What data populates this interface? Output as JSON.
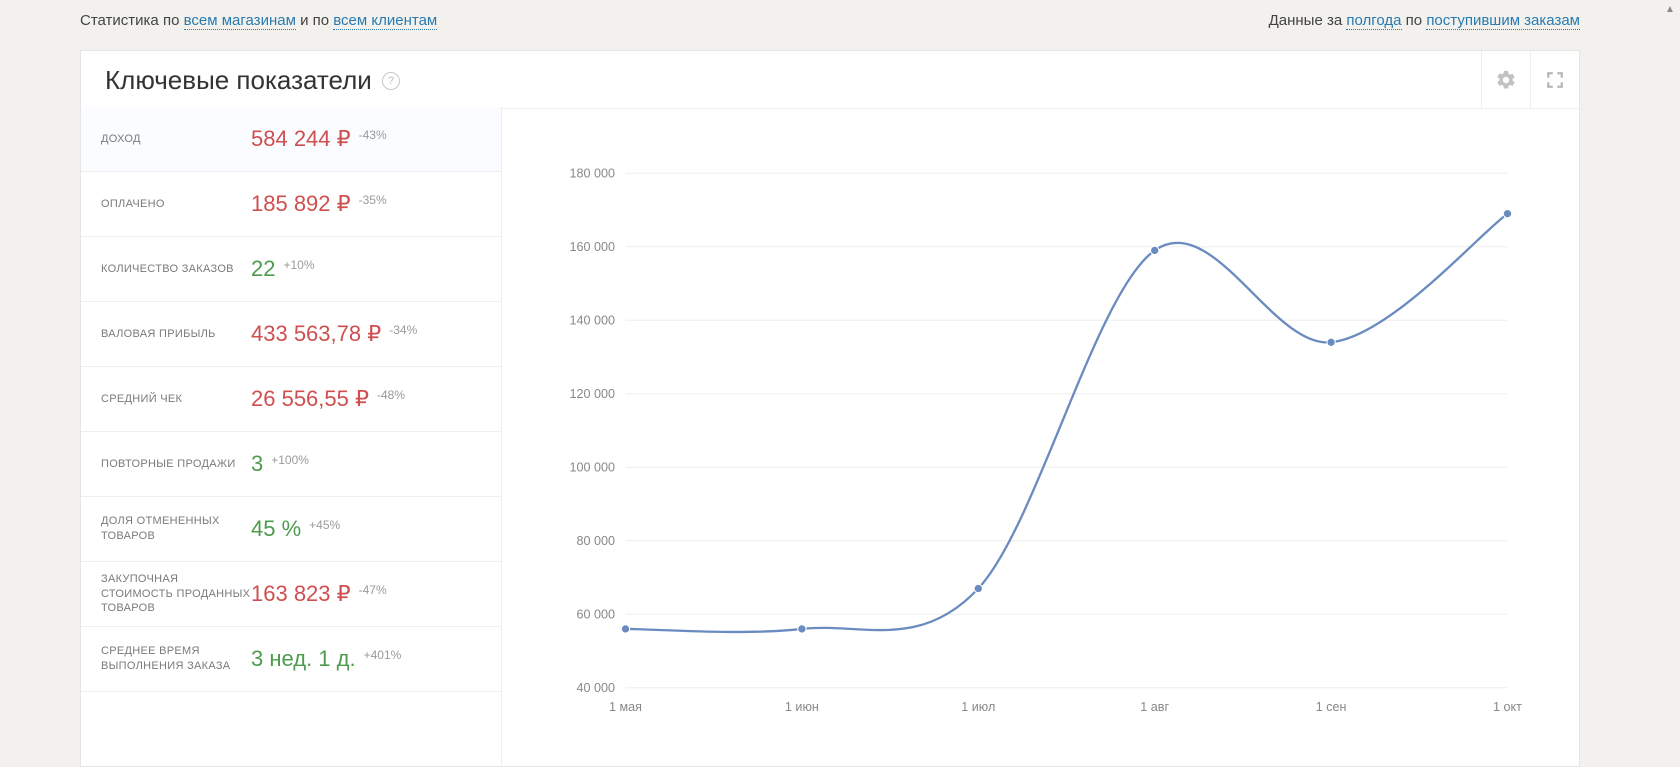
{
  "topbar": {
    "prefix_left": "Статистика по ",
    "link_shops": "всем магазинам",
    "mid_left": " и по ",
    "link_clients": "всем клиентам",
    "prefix_right": "Данные за ",
    "link_period": "полгода",
    "mid_right": " по ",
    "link_orders": "поступившим заказам"
  },
  "panel": {
    "title": "Ключевые показатели",
    "help": "?"
  },
  "metrics": [
    {
      "key": "revenue",
      "label": "ДОХОД",
      "value": "584 244 ₽",
      "delta": "-43%",
      "color": "red",
      "selected": true
    },
    {
      "key": "paid",
      "label": "ОПЛАЧЕНО",
      "value": "185 892 ₽",
      "delta": "-35%",
      "color": "red"
    },
    {
      "key": "orders",
      "label": "КОЛИЧЕСТВО ЗАКАЗОВ",
      "value": "22",
      "delta": "+10%",
      "color": "green"
    },
    {
      "key": "gross_profit",
      "label": "ВАЛОВАЯ ПРИБЫЛЬ",
      "value": "433 563,78 ₽",
      "delta": "-34%",
      "color": "red"
    },
    {
      "key": "avg_check",
      "label": "СРЕДНИЙ ЧЕК",
      "value": "26 556,55 ₽",
      "delta": "-48%",
      "color": "red"
    },
    {
      "key": "repeat_sales",
      "label": "ПОВТОРНЫЕ ПРОДАЖИ",
      "value": "3",
      "delta": "+100%",
      "color": "green"
    },
    {
      "key": "cancel_share",
      "label": "ДОЛЯ ОТМЕНЕННЫХ ТОВАРОВ",
      "value": "45 %",
      "delta": "+45%",
      "color": "green"
    },
    {
      "key": "cogs",
      "label": "ЗАКУПОЧНАЯ СТОИМОСТЬ ПРОДАННЫХ ТОВАРОВ",
      "value": "163 823 ₽",
      "delta": "-47%",
      "color": "red"
    },
    {
      "key": "avg_fulfilment",
      "label": "СРЕДНЕЕ ВРЕМЯ ВЫПОЛНЕНИЯ ЗАКАЗА",
      "value": "3 нед. 1 д.",
      "delta": "+401%",
      "color": "green"
    }
  ],
  "chart_data": {
    "type": "line",
    "title": "",
    "xlabel": "",
    "ylabel": "",
    "categories": [
      "1 мая",
      "1 июн",
      "1 июл",
      "1 авг",
      "1 сен",
      "1 окт"
    ],
    "values": [
      56000,
      56000,
      67000,
      159000,
      134000,
      169000
    ],
    "y_ticks": [
      40000,
      60000,
      80000,
      100000,
      120000,
      140000,
      160000,
      180000
    ],
    "ylim": [
      40000,
      180000
    ]
  }
}
